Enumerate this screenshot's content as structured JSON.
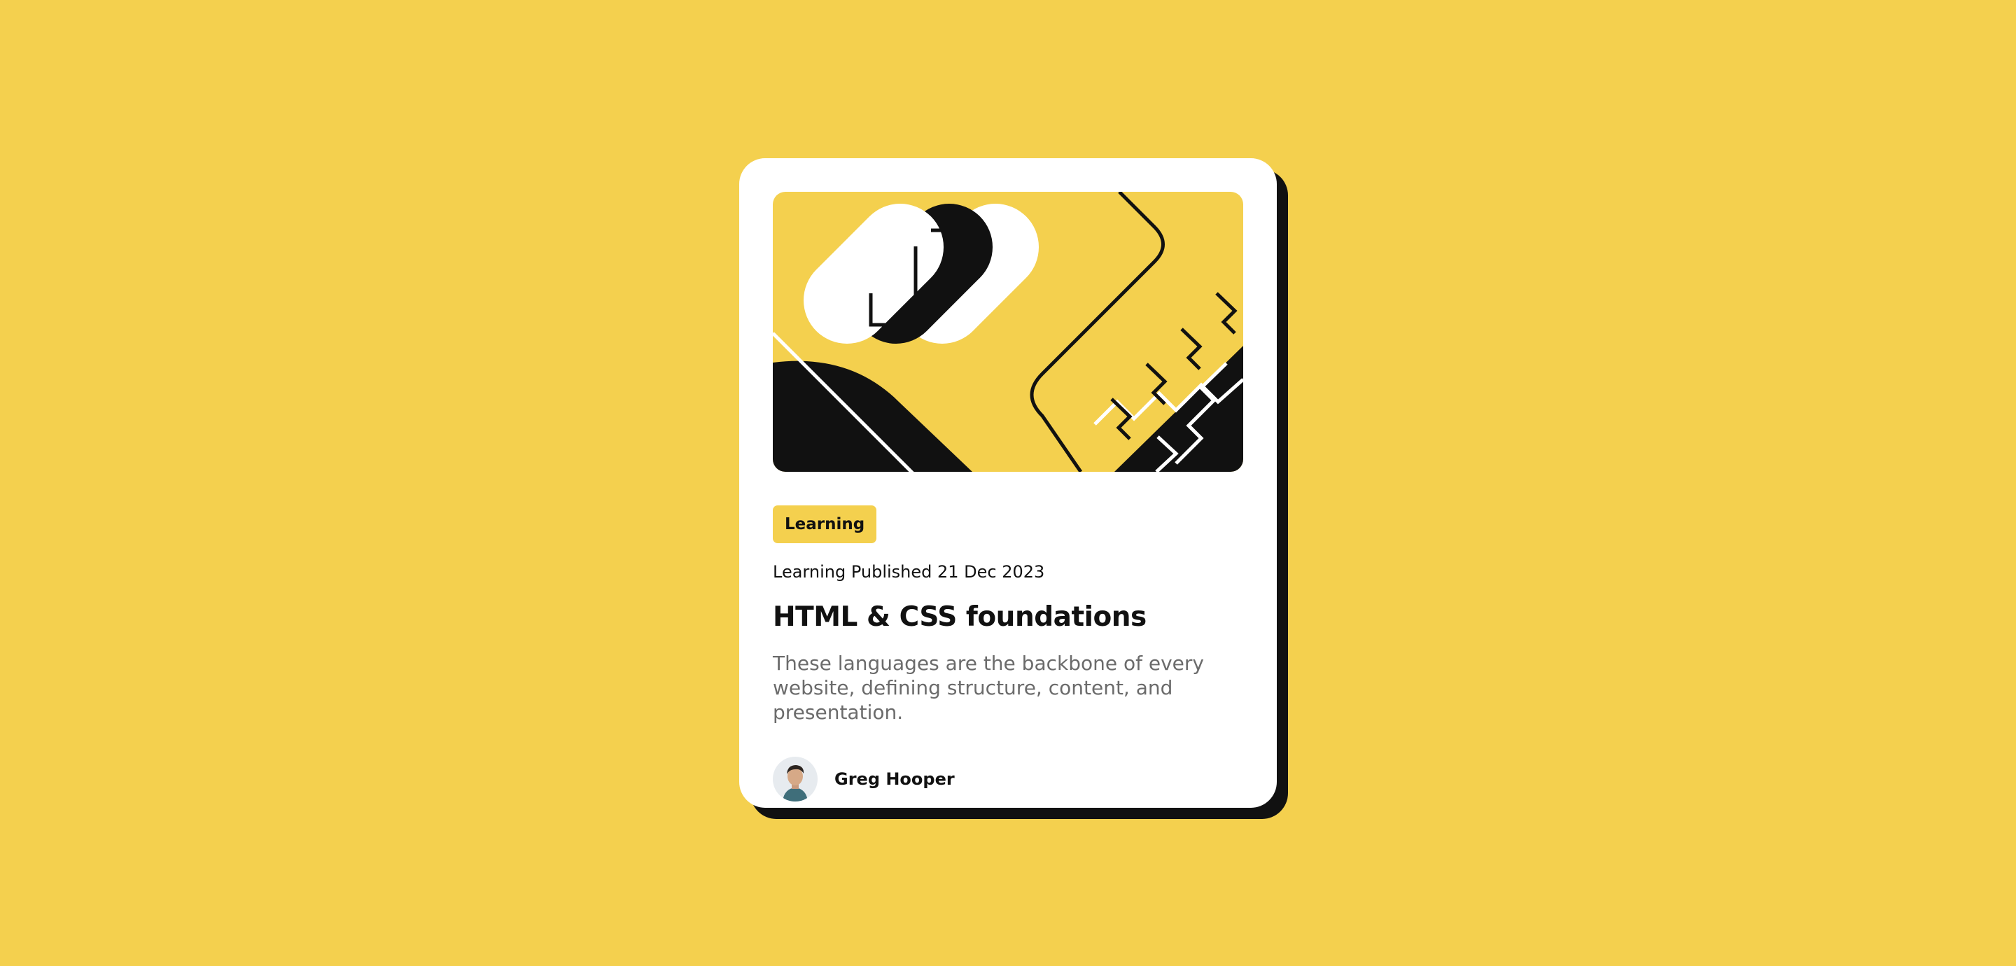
{
  "card": {
    "category": "Learning",
    "published": "Learning Published 21 Dec 2023",
    "title": "HTML & CSS foundations",
    "description": "These languages are the backbone of every website, defining structure, content, and presentation.",
    "author": {
      "name": "Greg Hooper"
    }
  },
  "colors": {
    "background": "#f4d04e",
    "card": "#ffffff",
    "text": "#111111",
    "muted_text": "#6b6b6b",
    "shadow": "#111111"
  },
  "icons": {
    "hero": "abstract-illustration",
    "avatar": "person-portrait"
  }
}
